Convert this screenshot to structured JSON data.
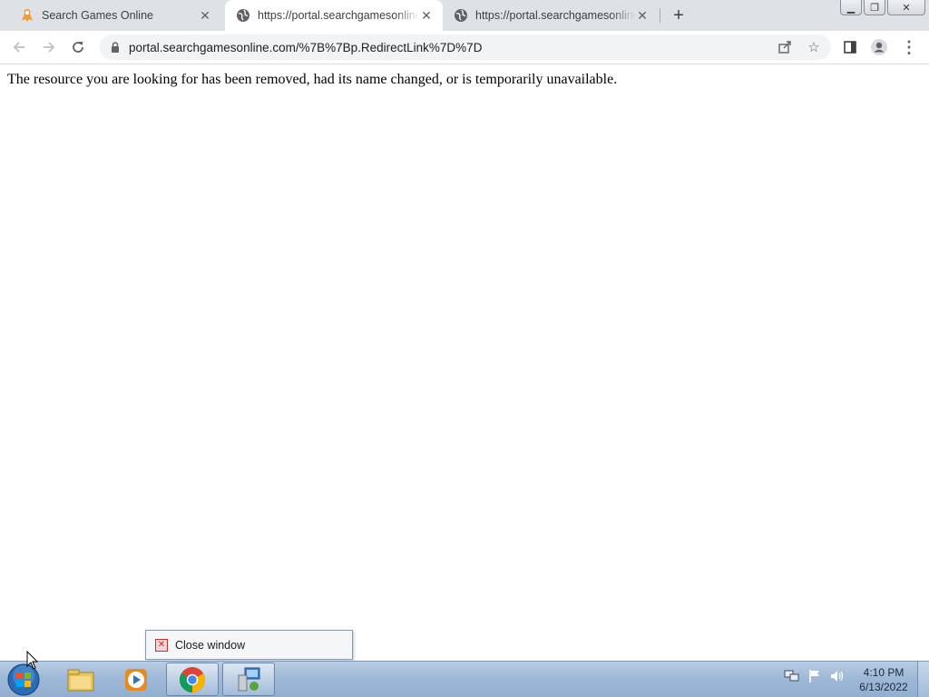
{
  "browser": {
    "tabs": [
      {
        "title": "Search Games Online",
        "active": false,
        "favicon": "search-games-icon"
      },
      {
        "title": "https://portal.searchgamesonline.com/",
        "active": true,
        "favicon": "globe-icon"
      },
      {
        "title": "https://portal.searchgamesonline.com/",
        "active": false,
        "favicon": "globe-icon"
      }
    ],
    "address_bar": {
      "url": "portal.searchgamesonline.com/%7B%7Bp.RedirectLink%7D%7D"
    }
  },
  "page": {
    "message": "The resource you are looking for has been removed, had its name changed, or is temporarily unavailable."
  },
  "popup": {
    "close_label": "Close window"
  },
  "taskbar": {
    "items": [
      "start-orb",
      "file-explorer",
      "media-player",
      "chrome",
      "network-app"
    ],
    "clock": {
      "time": "4:10 PM",
      "date": "6/13/2022"
    }
  }
}
